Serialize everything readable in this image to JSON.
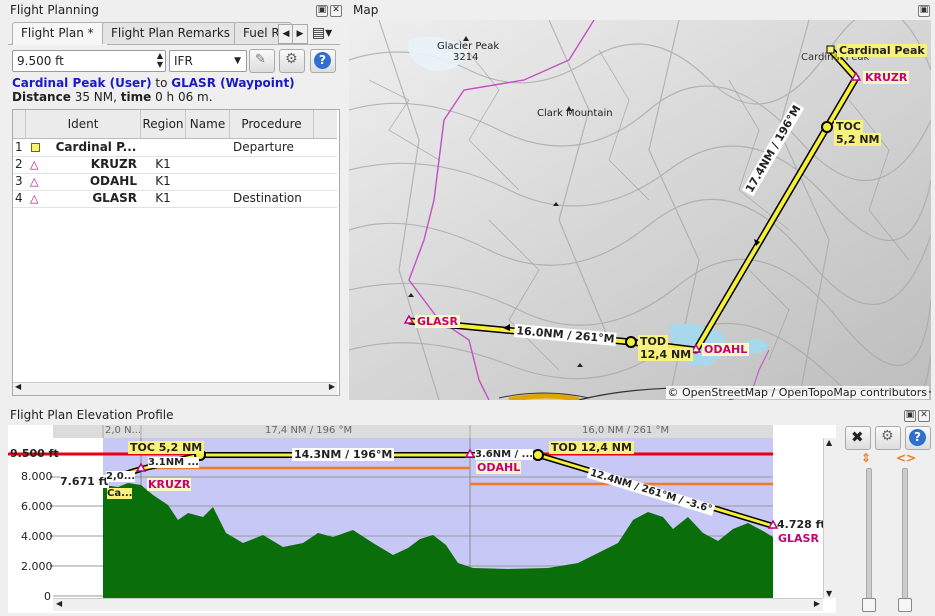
{
  "flight_planning": {
    "title": "Flight Planning",
    "tabs": [
      "Flight Plan *",
      "Flight Plan Remarks",
      "Fuel R"
    ],
    "altitude_value": "9.500 ft",
    "flight_rules": "IFR",
    "route_from": "Cardinal Peak (User)",
    "route_to_word": "to",
    "route_to": "GLASR (Waypoint)",
    "distance_label": "Distance",
    "distance_value": "35 NM,",
    "time_label": "time",
    "time_value": "0 h 06 m.",
    "columns": [
      "Ident",
      "Region",
      "Name",
      "Procedure"
    ],
    "rows": [
      {
        "n": "1",
        "ident": "Cardinal P...",
        "region": "",
        "name": "",
        "procedure": "Departure",
        "icon": "user-waypoint-square-icon"
      },
      {
        "n": "2",
        "ident": "KRUZR",
        "region": "K1",
        "name": "",
        "procedure": "",
        "icon": "waypoint-triangle-icon"
      },
      {
        "n": "3",
        "ident": "ODAHL",
        "region": "K1",
        "name": "",
        "procedure": "",
        "icon": "waypoint-triangle-icon"
      },
      {
        "n": "4",
        "ident": "GLASR",
        "region": "K1",
        "name": "",
        "procedure": "Destination",
        "icon": "waypoint-triangle-icon"
      }
    ]
  },
  "map": {
    "title": "Map",
    "labels": {
      "glacier_peak": "Glacier Peak",
      "glacier_peak_elev": "3214",
      "clark_mountain": "Clark Mountain",
      "cardinal_peak_dim": "Cardinal Peak",
      "cardinal_peak": "Cardinal Peak",
      "kruzr": "KRUZR",
      "toc": "TOC",
      "toc_dist": "5,2 NM",
      "leg1": "17.4NM / 196°M",
      "odahl": "ODAHL",
      "tod": "TOD",
      "tod_dist": "12,4 NM",
      "leg2": "16.0NM / 261°M",
      "glasr": "GLASR"
    },
    "attribution": "© OpenStreetMap / OpenTopoMap contributors"
  },
  "profile": {
    "title": "Flight Plan Elevation Profile",
    "header_segments": [
      "2,0 N...",
      "17,4 NM / 196 °M",
      "16,0 NM / 261 °M"
    ],
    "y_ticks": [
      "9.500 ft",
      "8.000",
      "6.000",
      "4.000",
      "2.000",
      "0"
    ],
    "start_alt": "7.671 ft",
    "end_alt": "4.728 ft",
    "toc_label": "TOC 5,2 NM",
    "tod_label": "TOD 12,4 NM",
    "seg_labels": {
      "first": "2,0...",
      "kruzr_leg": "3.1NM ...",
      "cruise1": "14.3NM / 196°M",
      "odahl_leg": "3.6NM / ...",
      "descent": "12.4NM / 261°M / -3.6°"
    },
    "waypoints": {
      "start": "Ca...",
      "kruzr": "KRUZR",
      "odahl": "ODAHL",
      "glasr": "GLASR"
    }
  },
  "colors": {
    "route": "#f5ef3a",
    "waypoint_magenta": "#c2007a",
    "terrain": "#0a6e0a",
    "sky": "#c7c8f5",
    "cruise_red": "#e8000d",
    "safe_orange": "#f07a20",
    "link_blue": "#1a1ac8"
  }
}
